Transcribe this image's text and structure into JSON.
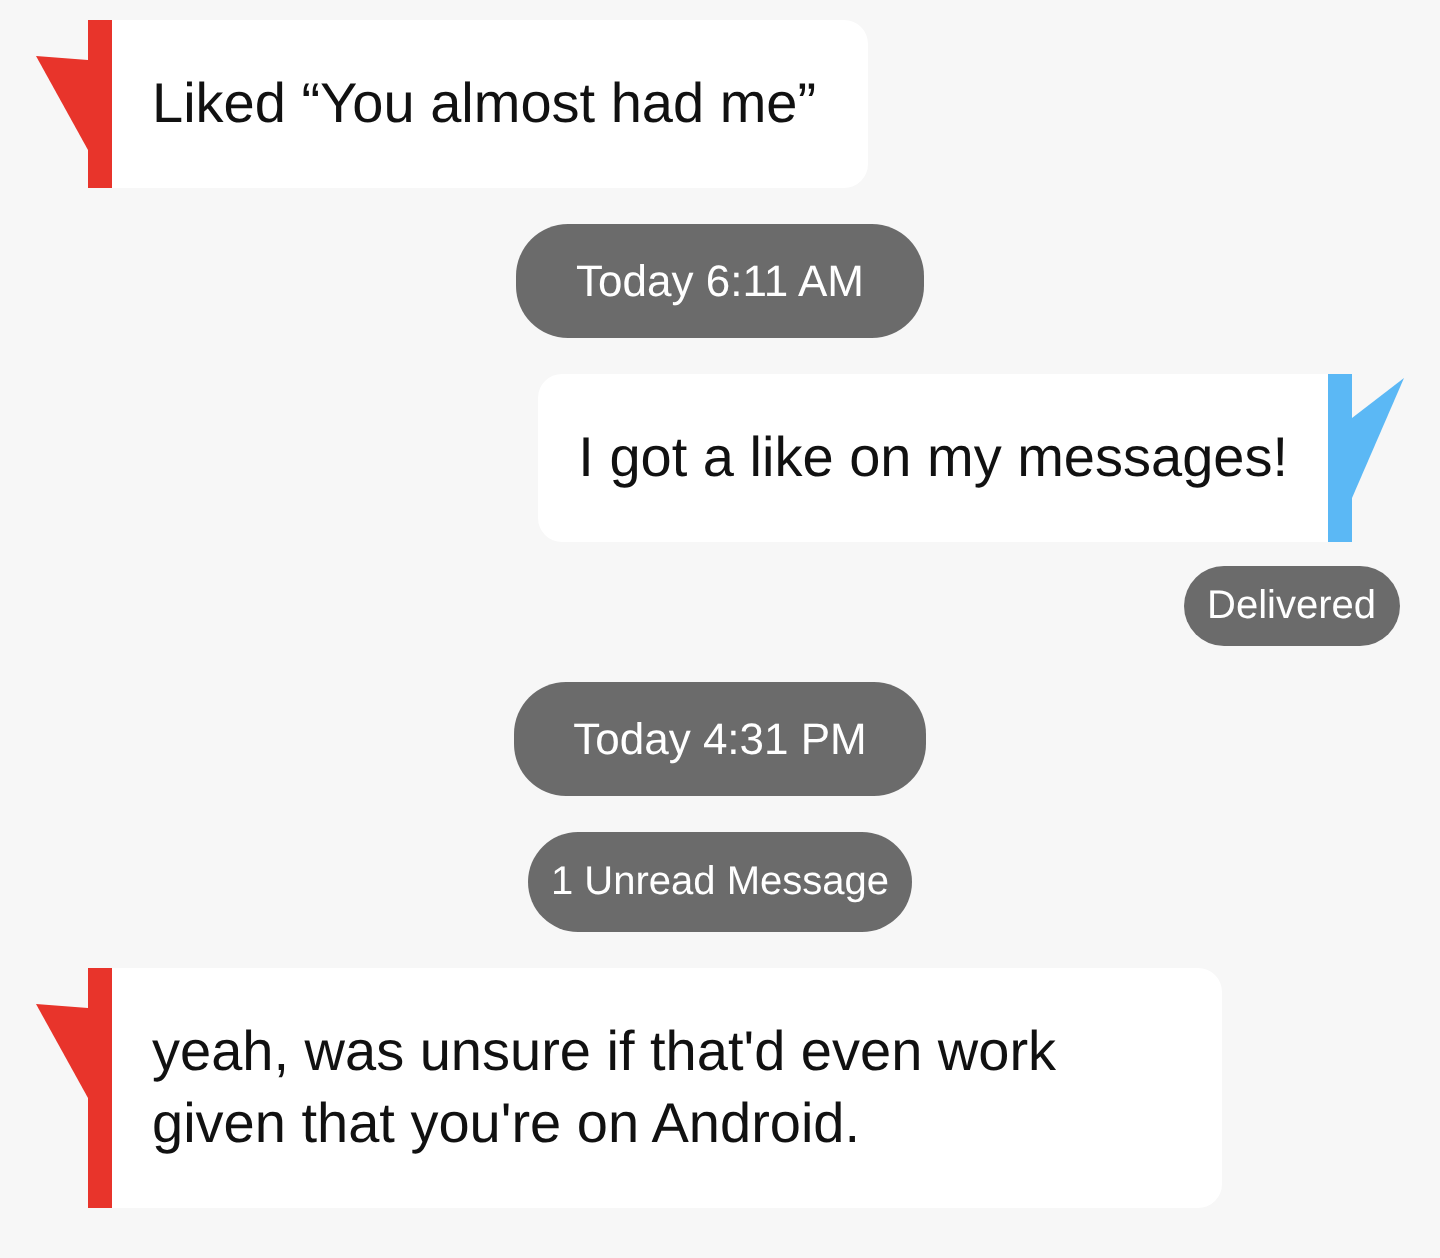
{
  "items": [
    {
      "kind": "incoming",
      "text": "Liked “You almost had me”",
      "color": "#e8342b"
    },
    {
      "kind": "timestamp",
      "text": "Today 6:11 AM"
    },
    {
      "kind": "outgoing",
      "text": "I got a like on my messages!",
      "color": "#5bb8f5"
    },
    {
      "kind": "status",
      "text": "Delivered"
    },
    {
      "kind": "timestamp",
      "text": "Today 4:31 PM"
    },
    {
      "kind": "unread",
      "text": "1 Unread Message"
    },
    {
      "kind": "incoming",
      "text": "yeah, was unsure if that'd even work given that you're on Android.",
      "color": "#e8342b"
    }
  ]
}
